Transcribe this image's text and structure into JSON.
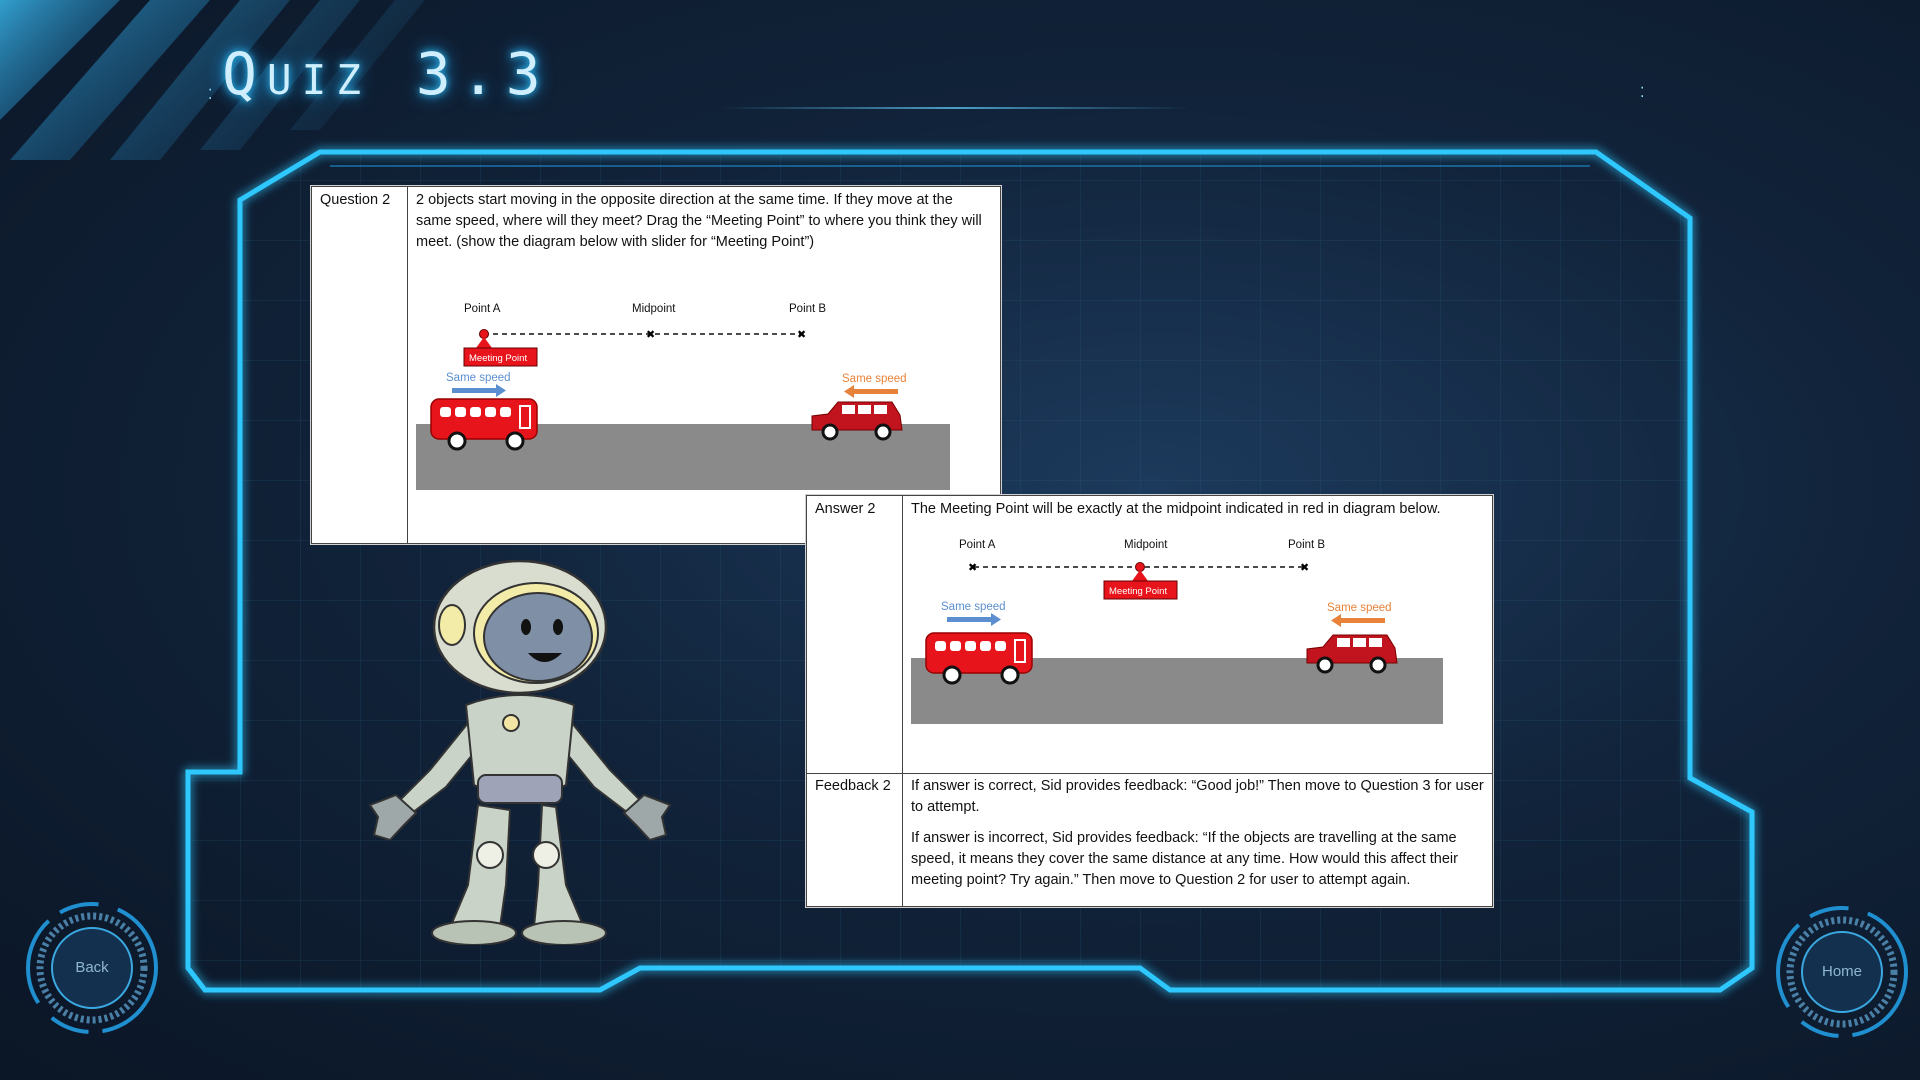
{
  "page": {
    "title": "Quiz 3.3"
  },
  "colors": {
    "frame_glow": "#2ec8ff",
    "meeting_point": "#e8141c",
    "speed_blue": "#5b8fd0",
    "speed_orange": "#e8823a",
    "road": "#8a8a8a"
  },
  "question": {
    "label": "Question 2",
    "text": "2 objects start moving in the opposite direction at the same time. If they move at the same speed, where will they meet? Drag the “Meeting Point” to where you think they will meet. (show the diagram below with slider for “Meeting Point”)",
    "diagram": {
      "point_a": "Point A",
      "midpoint": "Midpoint",
      "point_b": "Point B",
      "meeting_point": "Meeting Point",
      "speed_left": "Same speed",
      "speed_right": "Same speed"
    }
  },
  "answer": {
    "label": "Answer 2",
    "text": "The Meeting Point will be exactly at the midpoint indicated in red in diagram below.",
    "diagram": {
      "point_a": "Point A",
      "midpoint": "Midpoint",
      "point_b": "Point B",
      "meeting_point": "Meeting Point",
      "speed_left": "Same speed",
      "speed_right": "Same speed"
    }
  },
  "feedback": {
    "label": "Feedback 2",
    "correct": "If answer is correct, Sid provides feedback: “Good job!” Then move to Question 3 for user to attempt.",
    "incorrect": "If answer is incorrect, Sid provides feedback: “If the objects are travelling at the same speed, it means they cover the same distance at any time. How would this affect their meeting point? Try again.” Then move to Question 2 for user to attempt again."
  },
  "nav": {
    "back": "Back",
    "home": "Home"
  },
  "icons": {
    "back": "back-ring-icon",
    "home": "home-ring-icon",
    "mascot": "robot-mascot"
  }
}
